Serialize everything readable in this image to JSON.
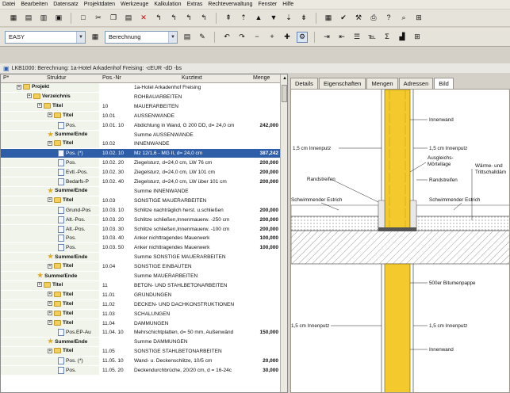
{
  "menu": [
    "Datei",
    "Bearbeiten",
    "Datensatz",
    "Projektdaten",
    "Werkzeuge",
    "Kalkulation",
    "Extras",
    "Rechteverwaltung",
    "Fenster",
    "Hilfe"
  ],
  "toolbar2": {
    "mode_value": "EASY",
    "view_value": "Berechnung"
  },
  "window_title": "LKB1000: Berechnung: 1a-Hotel Arkadenhof Freising: -cEUR -dD -bs",
  "grid": {
    "headers": {
      "col0": "P*",
      "struktur": "Struktur",
      "pos": "Pos.-Nr",
      "kurztext": "Kurztext",
      "menge": "Menge"
    },
    "rows": [
      {
        "node": "Projekt",
        "icon": "folder",
        "level": 0,
        "pos": "",
        "text": "1a-Hotel Arkadenhof Freising",
        "qty": ""
      },
      {
        "node": "Verzeichnis",
        "icon": "folder",
        "level": 1,
        "pos": "",
        "text": "ROHBAUARBEITEN",
        "qty": ""
      },
      {
        "node": "Titel",
        "icon": "folder",
        "level": 2,
        "pos": "10",
        "text": "MAUERARBEITEN",
        "qty": ""
      },
      {
        "node": "Titel",
        "icon": "folder",
        "level": 3,
        "pos": "10.01",
        "text": "AUSSENWÄNDE",
        "qty": ""
      },
      {
        "node": "Pos.",
        "icon": "doc",
        "level": 4,
        "pos": "10.01. 10",
        "text": "Abdichtung in Wand, G 200 DD, d= 24,0 cm",
        "qty": "242,000"
      },
      {
        "node": "Summe/Ende",
        "icon": "star",
        "level": 3,
        "pos": "",
        "text": "Summe AUSSENWÄNDE",
        "qty": ""
      },
      {
        "node": "Titel",
        "icon": "folder",
        "level": 3,
        "pos": "10.02",
        "text": "INNENWÄNDE",
        "qty": ""
      },
      {
        "node": "Pos. (*)",
        "icon": "doc",
        "level": 4,
        "pos": "10.02. 10",
        "text": "Mz 12/1,6 - MG II, d= 24,0 cm",
        "qty": "387,242",
        "selected": true
      },
      {
        "node": "Pos.",
        "icon": "doc",
        "level": 4,
        "pos": "10.02. 20",
        "text": "Ziegelsturz, d=24,0 cm, LW 76 cm",
        "qty": "200,000"
      },
      {
        "node": "Evtl.-Pos.",
        "icon": "doc",
        "level": 4,
        "pos": "10.02. 30",
        "text": "Ziegelsturz, d=24,0 cm, LW 101 cm",
        "qty": "200,000"
      },
      {
        "node": "Bedarfs-P",
        "icon": "doc",
        "level": 4,
        "pos": "10.02. 40",
        "text": "Ziegelsturz, d=24,0 cm, LW über 101 cm",
        "qty": "200,000"
      },
      {
        "node": "Summe/Ende",
        "icon": "star",
        "level": 3,
        "pos": "",
        "text": "Summe INNENWÄNDE",
        "qty": ""
      },
      {
        "node": "Titel",
        "icon": "folder",
        "level": 3,
        "pos": "10.03",
        "text": "SONSTIGE MAUERARBEITEN",
        "qty": ""
      },
      {
        "node": "Grund-Pos",
        "icon": "doc",
        "level": 4,
        "pos": "10.03. 10",
        "text": "Schlitze nachträglich herst. u.schließen",
        "qty": "200,000"
      },
      {
        "node": "Alt.-Pos.",
        "icon": "doc",
        "level": 4,
        "pos": "10.03. 20",
        "text": "Schlitze schließen,Innenmauerw. -250 cm",
        "qty": "200,000"
      },
      {
        "node": "Alt.-Pos.",
        "icon": "doc",
        "level": 4,
        "pos": "10.03. 30",
        "text": "Schlitze schließen,Innenmauerw. -100 cm",
        "qty": "200,000"
      },
      {
        "node": "Pos.",
        "icon": "doc",
        "level": 4,
        "pos": "10.03. 40",
        "text": "Anker nichttragendes Mauerwerk",
        "qty": "100,000"
      },
      {
        "node": "Pos.",
        "icon": "doc",
        "level": 4,
        "pos": "10.03. 50",
        "text": "Anker nichttragendes Mauerwerk",
        "qty": "100,000"
      },
      {
        "node": "Summe/Ende",
        "icon": "star",
        "level": 3,
        "pos": "",
        "text": "Summe SONSTIGE MAUERARBEITEN",
        "qty": ""
      },
      {
        "node": "Titel",
        "icon": "folder",
        "level": 3,
        "pos": "10.04",
        "text": "SONSTIGE EINBAUTEN",
        "qty": ""
      },
      {
        "node": "Summe/Ende",
        "icon": "star",
        "level": 2,
        "pos": "",
        "text": "Summe MAUERARBEITEN",
        "qty": ""
      },
      {
        "node": "Titel",
        "icon": "folder",
        "level": 2,
        "pos": "11",
        "text": "BETON- UND STAHLBETONARBEITEN",
        "qty": ""
      },
      {
        "node": "Titel",
        "icon": "folder",
        "level": 3,
        "pos": "11.01",
        "text": "GRÜNDUNGEN",
        "qty": ""
      },
      {
        "node": "Titel",
        "icon": "folder",
        "level": 3,
        "pos": "11.02",
        "text": "DECKEN- UND DACHKONSTRUKTIONEN",
        "qty": ""
      },
      {
        "node": "Titel",
        "icon": "folder",
        "level": 3,
        "pos": "11.03",
        "text": "SCHALUNGEN",
        "qty": ""
      },
      {
        "node": "Titel",
        "icon": "folder",
        "level": 3,
        "pos": "11.04",
        "text": "DÄMMUNGEN",
        "qty": ""
      },
      {
        "node": "Pos.EP-Au",
        "icon": "doc",
        "level": 4,
        "pos": "11.04. 10",
        "text": "Mehrschichtplatten, d= 50 mm, Außenwänd",
        "qty": "150,000"
      },
      {
        "node": "Summe/Ende",
        "icon": "star",
        "level": 3,
        "pos": "",
        "text": "Summe DÄMMUNGEN",
        "qty": ""
      },
      {
        "node": "Titel",
        "icon": "folder",
        "level": 3,
        "pos": "11.05",
        "text": "SONSTIGE STAHLBETONARBEITEN",
        "qty": ""
      },
      {
        "node": "Pos. (*)",
        "icon": "doc",
        "level": 4,
        "pos": "11.05. 10",
        "text": "Wand- u. Deckenschlitze, 10/5 cm",
        "qty": "20,000"
      },
      {
        "node": "Pos.",
        "icon": "doc",
        "level": 4,
        "pos": "11.05. 20",
        "text": "Deckendurchbrüche, 20/20 cm, d = 16-24c",
        "qty": "30,000"
      }
    ]
  },
  "tabs": [
    {
      "label": "Details",
      "active": false
    },
    {
      "label": "Eigenschaften",
      "active": false
    },
    {
      "label": "Mengen",
      "active": false
    },
    {
      "label": "Adressen",
      "active": false
    },
    {
      "label": "Bild",
      "active": true
    }
  ],
  "drawing": {
    "labels": {
      "innenwand_top": "Innenwand",
      "innenputz_left_top": "1,5 cm Innenputz",
      "innenputz_right_top": "1,5 cm Innenputz",
      "ausgleich": "Ausgleichs-\nMörtellage",
      "randstreifen_left": "Randstreifen",
      "randstreifen_right": "Randstreifen",
      "waerme": "Wärme- und\nTrittschalldäm",
      "estrich_left": "Schwimmender Estrich",
      "estrich_right": "Schwimmender Estrich",
      "bitumenpappe": "500er Bitumenpappe",
      "innenputz_left_bot": "1,5 cm Innenputz",
      "innenputz_right_bot": "1,5 cm Innenputz",
      "innenwand_bot": "Innenwand"
    },
    "colors": {
      "wall": "#f3c92e",
      "hatch": "#b9b9b9"
    }
  }
}
